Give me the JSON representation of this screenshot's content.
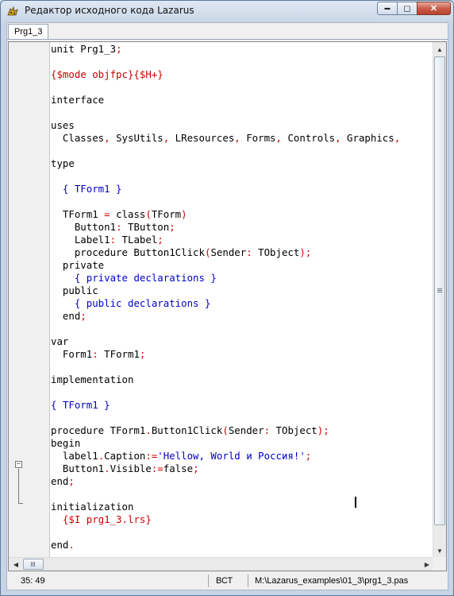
{
  "window": {
    "title": "Редактор исходного кода Lazarus",
    "icon": "lazarus-cheetah-icon"
  },
  "titlebar_buttons": {
    "minimize": "▬",
    "maximize": "◻",
    "close": "✕"
  },
  "tabs": [
    {
      "label": "Prg1_3",
      "active": true
    }
  ],
  "code_lines": [
    [
      [
        "unit Prg1_3",
        ""
      ],
      [
        ";",
        "sym"
      ]
    ],
    [],
    [
      [
        "{$mode objfpc}{$H+}",
        "dir"
      ]
    ],
    [],
    [
      [
        "interface",
        ""
      ]
    ],
    [],
    [
      [
        "uses",
        ""
      ]
    ],
    [
      [
        "  Classes",
        ""
      ],
      [
        ",",
        "sym"
      ],
      [
        " SysUtils",
        ""
      ],
      [
        ",",
        "sym"
      ],
      [
        " LResources",
        ""
      ],
      [
        ",",
        "sym"
      ],
      [
        " Forms",
        ""
      ],
      [
        ",",
        "sym"
      ],
      [
        " Controls",
        ""
      ],
      [
        ",",
        "sym"
      ],
      [
        " Graphics",
        ""
      ],
      [
        ",",
        "sym"
      ],
      [
        " ",
        ""
      ]
    ],
    [],
    [
      [
        "type",
        ""
      ]
    ],
    [],
    [
      [
        "  ",
        ""
      ],
      [
        "{ TForm1 }",
        "cmt"
      ]
    ],
    [],
    [
      [
        "  TForm1 ",
        ""
      ],
      [
        "=",
        "sym"
      ],
      [
        " class",
        ""
      ],
      [
        "(",
        "sym"
      ],
      [
        "TForm",
        ""
      ],
      [
        ")",
        "sym"
      ]
    ],
    [
      [
        "    Button1",
        ""
      ],
      [
        ":",
        "sym"
      ],
      [
        " TButton",
        ""
      ],
      [
        ";",
        "sym"
      ]
    ],
    [
      [
        "    Label1",
        ""
      ],
      [
        ":",
        "sym"
      ],
      [
        " TLabel",
        ""
      ],
      [
        ";",
        "sym"
      ]
    ],
    [
      [
        "    procedure Button1Click",
        ""
      ],
      [
        "(",
        "sym"
      ],
      [
        "Sender",
        ""
      ],
      [
        ":",
        "sym"
      ],
      [
        " TObject",
        ""
      ],
      [
        ");",
        "sym"
      ]
    ],
    [
      [
        "  private",
        ""
      ]
    ],
    [
      [
        "    ",
        ""
      ],
      [
        "{ private declarations }",
        "cmt"
      ]
    ],
    [
      [
        "  public",
        ""
      ]
    ],
    [
      [
        "    ",
        ""
      ],
      [
        "{ public declarations }",
        "cmt"
      ]
    ],
    [
      [
        "  end",
        ""
      ],
      [
        ";",
        "sym"
      ]
    ],
    [],
    [
      [
        "var",
        ""
      ]
    ],
    [
      [
        "  Form1",
        ""
      ],
      [
        ":",
        "sym"
      ],
      [
        " TForm1",
        ""
      ],
      [
        ";",
        "sym"
      ]
    ],
    [],
    [
      [
        "implementation",
        ""
      ]
    ],
    [],
    [
      [
        "{ TForm1 }",
        "cmt"
      ]
    ],
    [],
    [
      [
        "procedure TForm1",
        ""
      ],
      [
        ".",
        "sym"
      ],
      [
        "Button1Click",
        ""
      ],
      [
        "(",
        "sym"
      ],
      [
        "Sender",
        ""
      ],
      [
        ":",
        "sym"
      ],
      [
        " TObject",
        ""
      ],
      [
        ");",
        "sym"
      ]
    ],
    [
      [
        "begin",
        ""
      ]
    ],
    [
      [
        "  label1",
        ""
      ],
      [
        ".",
        "sym"
      ],
      [
        "Caption",
        ""
      ],
      [
        ":=",
        "sym"
      ],
      [
        "'Hellow, World и Россия!'",
        "str"
      ],
      [
        ";",
        "sym"
      ]
    ],
    [
      [
        "  Button1",
        ""
      ],
      [
        ".",
        "sym"
      ],
      [
        "Visible",
        ""
      ],
      [
        ":=",
        "sym"
      ],
      [
        "false",
        ""
      ],
      [
        ";",
        "sym"
      ]
    ],
    [
      [
        "end",
        ""
      ],
      [
        ";",
        "sym"
      ]
    ],
    [],
    [
      [
        "initialization",
        ""
      ]
    ],
    [
      [
        "  ",
        ""
      ],
      [
        "{$I prg1_3.lrs}",
        "dir"
      ]
    ],
    [],
    [
      [
        "end",
        ""
      ],
      [
        ".",
        "sym"
      ]
    ]
  ],
  "status": {
    "position": "35:  49",
    "mode": "ВСТ",
    "file": "M:\\Lazarus_examples\\01_3\\prg1_3.pas"
  },
  "colors": {
    "symbol": "#cc0000",
    "string": "#0000cc",
    "comment": "#0000cc",
    "directive": "#cc0000",
    "close_button": "#c75a45"
  }
}
